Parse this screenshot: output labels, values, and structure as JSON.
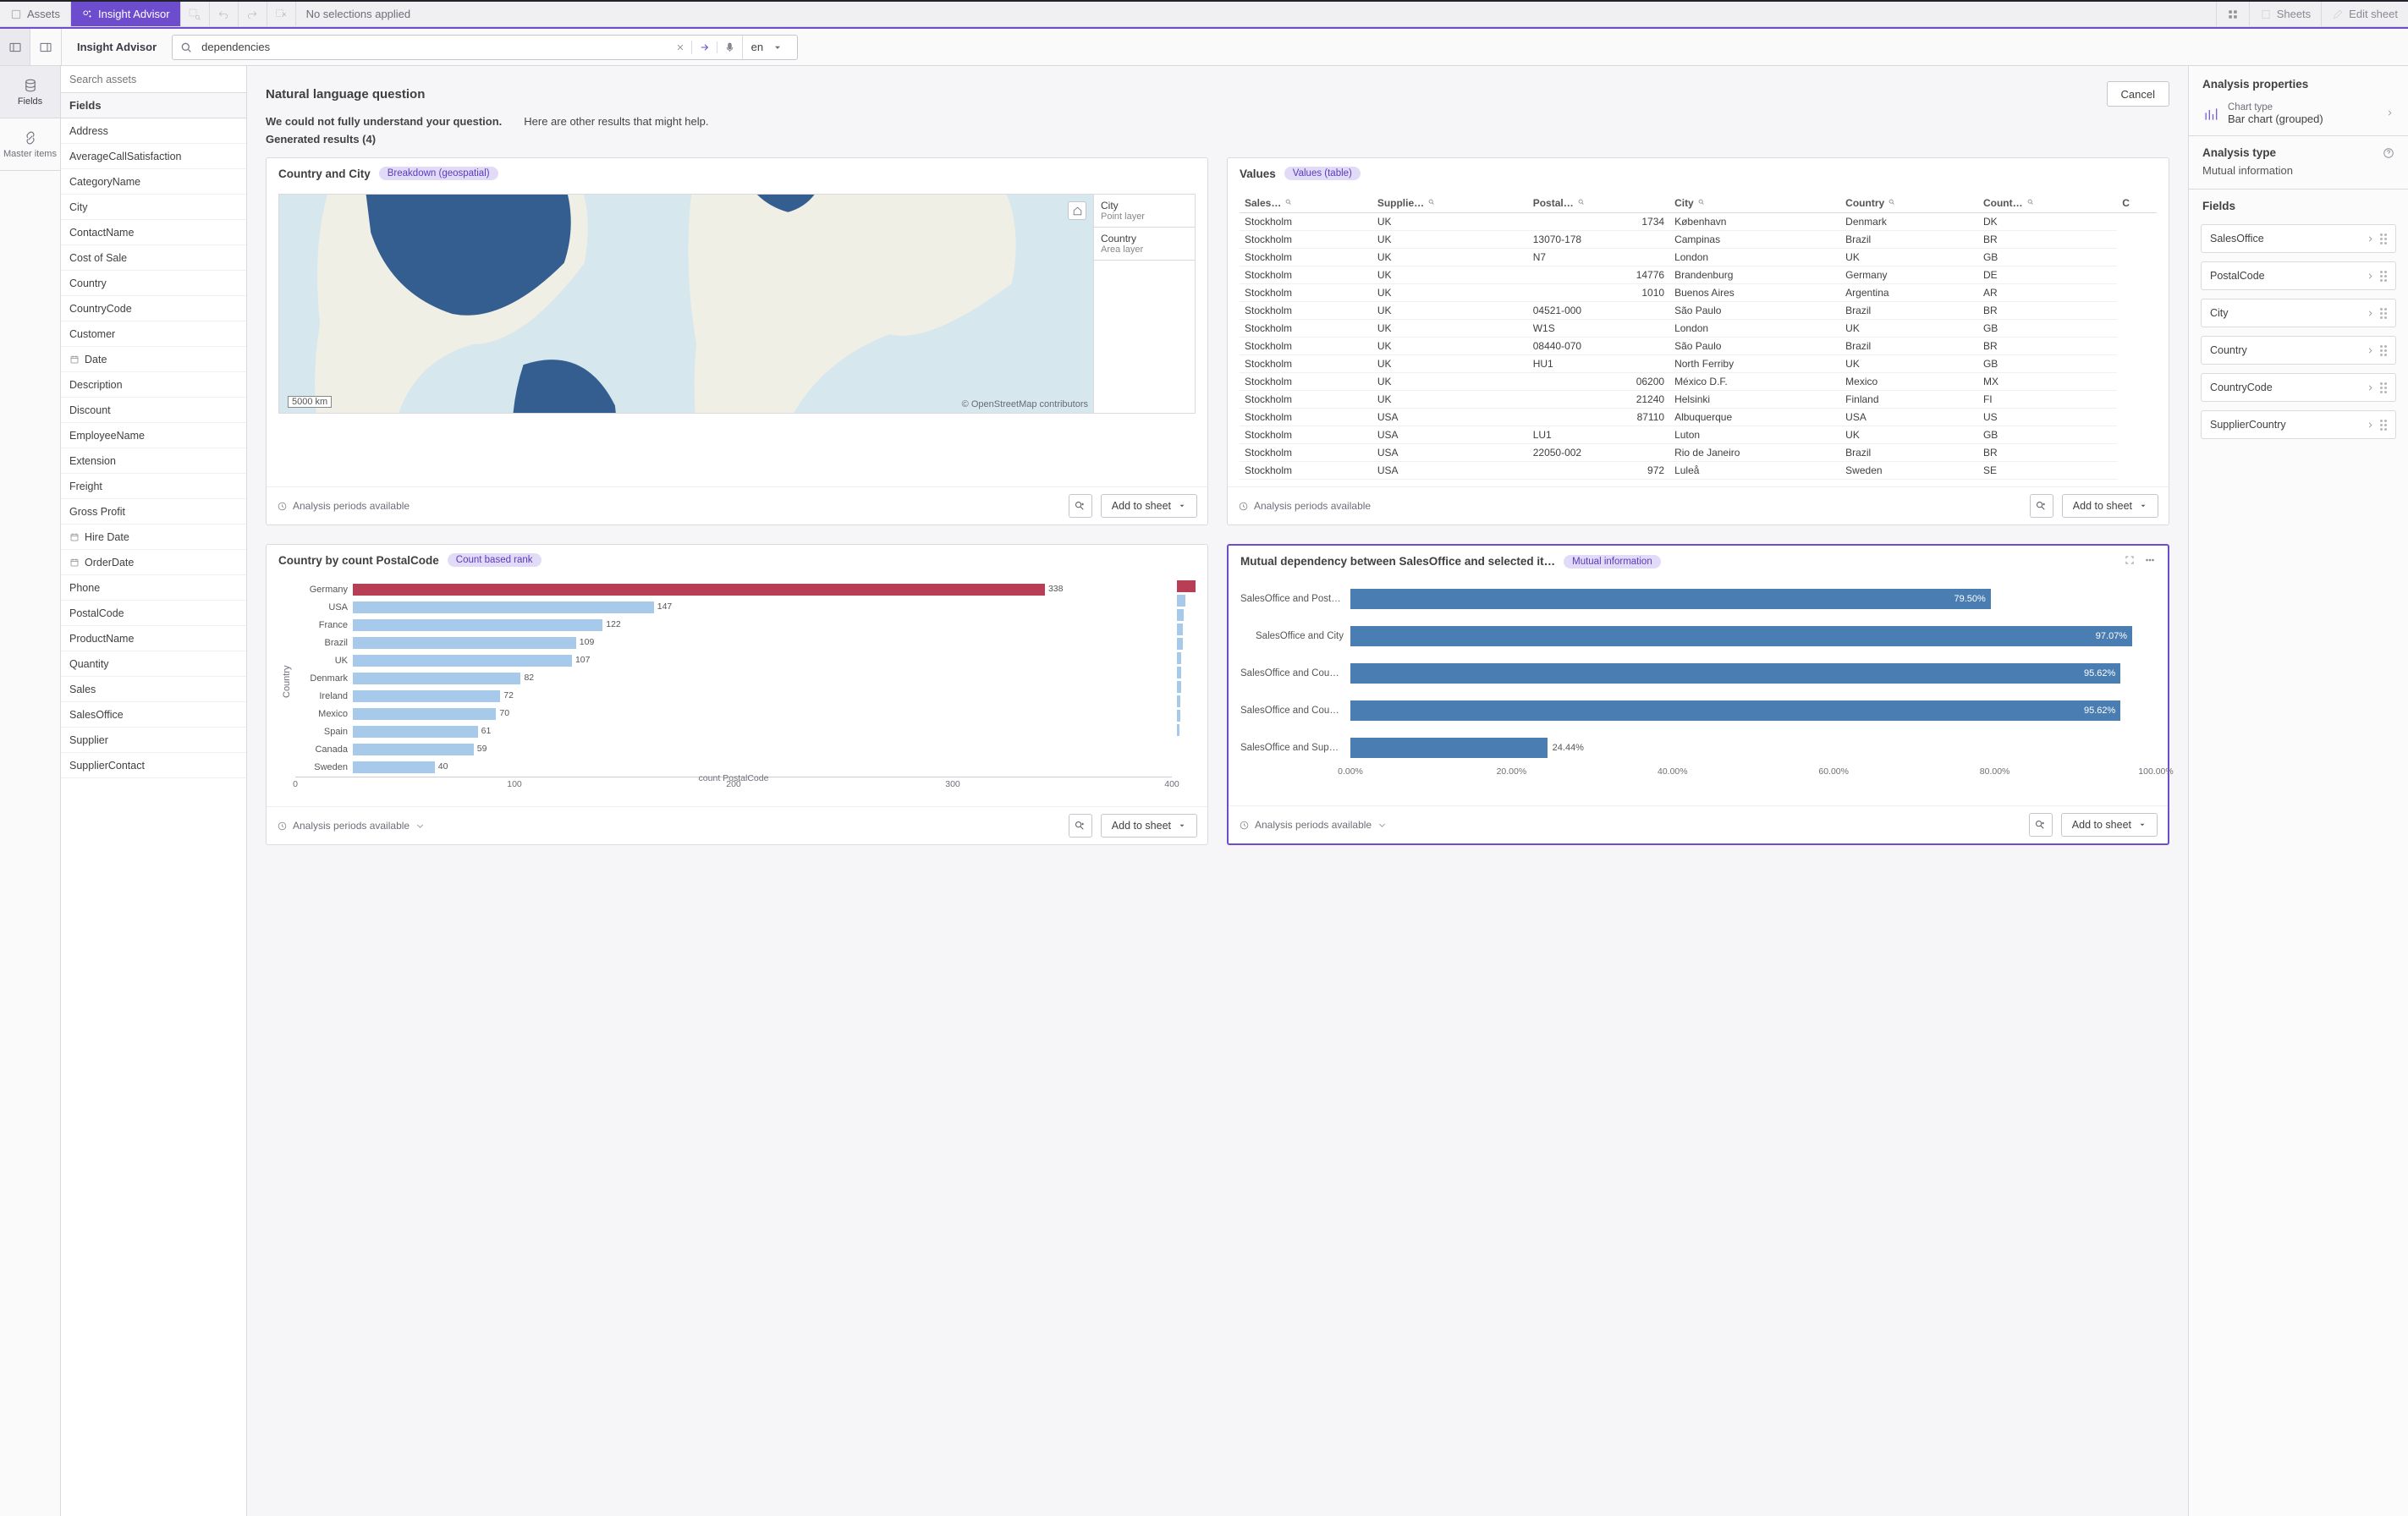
{
  "selection_bar": {
    "assets_label": "Assets",
    "insight_label": "Insight Advisor",
    "no_selections": "No selections applied",
    "sheets_label": "Sheets",
    "edit_label": "Edit sheet"
  },
  "ia": {
    "title": "Insight Advisor",
    "search_value": "dependencies",
    "lang": "en"
  },
  "rail": {
    "fields": "Fields",
    "master": "Master items"
  },
  "assets": {
    "search_placeholder": "Search assets",
    "head": "Fields",
    "list": [
      {
        "label": "Address"
      },
      {
        "label": "AverageCallSatisfaction"
      },
      {
        "label": "CategoryName"
      },
      {
        "label": "City"
      },
      {
        "label": "ContactName"
      },
      {
        "label": "Cost of Sale"
      },
      {
        "label": "Country"
      },
      {
        "label": "CountryCode"
      },
      {
        "label": "Customer"
      },
      {
        "label": "Date",
        "icon": "calendar"
      },
      {
        "label": "Description"
      },
      {
        "label": "Discount"
      },
      {
        "label": "EmployeeName"
      },
      {
        "label": "Extension"
      },
      {
        "label": "Freight"
      },
      {
        "label": "Gross Profit"
      },
      {
        "label": "Hire Date",
        "icon": "calendar"
      },
      {
        "label": "OrderDate",
        "icon": "calendar"
      },
      {
        "label": "Phone"
      },
      {
        "label": "PostalCode"
      },
      {
        "label": "ProductName"
      },
      {
        "label": "Quantity"
      },
      {
        "label": "Sales"
      },
      {
        "label": "SalesOffice"
      },
      {
        "label": "Supplier"
      },
      {
        "label": "SupplierContact"
      }
    ]
  },
  "center": {
    "nlq": "Natural language question",
    "cancel": "Cancel",
    "could_not": "We could not fully understand your question.",
    "other": "Here are other results that might help.",
    "generated": "Generated results (4)"
  },
  "cards": {
    "map": {
      "title": "Country and City",
      "badge": "Breakdown (geospatial)",
      "legend_city": "City",
      "legend_city_sub": "Point layer",
      "legend_country": "Country",
      "legend_country_sub": "Area layer",
      "scale": "5000 km",
      "attrib": "© OpenStreetMap contributors"
    },
    "values": {
      "title": "Values",
      "badge": "Values (table)",
      "columns": [
        "Sales…",
        "Supplie…",
        "Postal…",
        "City",
        "Country",
        "Count…",
        "C"
      ],
      "rows": [
        [
          "Stockholm",
          "UK",
          "1734",
          "København",
          "Denmark",
          "DK"
        ],
        [
          "Stockholm",
          "UK",
          "13070-178",
          "Campinas",
          "Brazil",
          "BR"
        ],
        [
          "Stockholm",
          "UK",
          "N7",
          "London",
          "UK",
          "GB"
        ],
        [
          "Stockholm",
          "UK",
          "14776",
          "Brandenburg",
          "Germany",
          "DE"
        ],
        [
          "Stockholm",
          "UK",
          "1010",
          "Buenos Aires",
          "Argentina",
          "AR"
        ],
        [
          "Stockholm",
          "UK",
          "04521-000",
          "São Paulo",
          "Brazil",
          "BR"
        ],
        [
          "Stockholm",
          "UK",
          "W1S",
          "London",
          "UK",
          "GB"
        ],
        [
          "Stockholm",
          "UK",
          "08440-070",
          "São Paulo",
          "Brazil",
          "BR"
        ],
        [
          "Stockholm",
          "UK",
          "HU1",
          "North Ferriby",
          "UK",
          "GB"
        ],
        [
          "Stockholm",
          "UK",
          "06200",
          "México D.F.",
          "Mexico",
          "MX"
        ],
        [
          "Stockholm",
          "UK",
          "21240",
          "Helsinki",
          "Finland",
          "FI"
        ],
        [
          "Stockholm",
          "USA",
          "87110",
          "Albuquerque",
          "USA",
          "US"
        ],
        [
          "Stockholm",
          "USA",
          "LU1",
          "Luton",
          "UK",
          "GB"
        ],
        [
          "Stockholm",
          "USA",
          "22050-002",
          "Rio de Janeiro",
          "Brazil",
          "BR"
        ],
        [
          "Stockholm",
          "USA",
          "972",
          "Luleå",
          "Sweden",
          "SE"
        ]
      ]
    },
    "countbar": {
      "title": "Country by count PostalCode",
      "badge": "Count based rank"
    },
    "mi": {
      "title": "Mutual dependency between SalesOffice and selected it…",
      "badge": "Mutual information"
    },
    "periods": "Analysis periods available",
    "add": "Add to sheet"
  },
  "right": {
    "props": "Analysis properties",
    "chart_type_label": "Chart type",
    "chart_type_value": "Bar chart (grouped)",
    "atype_label": "Analysis type",
    "atype_value": "Mutual information",
    "fields_label": "Fields",
    "fields": [
      "SalesOffice",
      "PostalCode",
      "City",
      "Country",
      "CountryCode",
      "SupplierCountry"
    ]
  },
  "chart_data": [
    {
      "type": "bar",
      "orientation": "horizontal",
      "title": "Country by count PostalCode",
      "ylabel": "Country",
      "xlabel": "count PostalCode",
      "xlim": [
        0,
        400
      ],
      "xticks": [
        0,
        100,
        200,
        300,
        400
      ],
      "categories": [
        "Germany",
        "USA",
        "France",
        "Brazil",
        "UK",
        "Denmark",
        "Ireland",
        "Mexico",
        "Spain",
        "Canada",
        "Sweden"
      ],
      "values": [
        338,
        147,
        122,
        109,
        107,
        82,
        72,
        70,
        61,
        59,
        40
      ],
      "highlight_index": 0
    },
    {
      "type": "bar",
      "orientation": "horizontal",
      "title": "Mutual dependency between SalesOffice and selected items",
      "xlim": [
        0,
        100
      ],
      "xticks": [
        0,
        20,
        40,
        60,
        80,
        100
      ],
      "xformat": "percent",
      "categories": [
        "SalesOffice and PostalCode",
        "SalesOffice and City",
        "SalesOffice and Country",
        "SalesOffice and CountryCo…",
        "SalesOffice and SupplierC…"
      ],
      "values": [
        79.5,
        97.07,
        95.62,
        95.62,
        24.44
      ]
    }
  ]
}
